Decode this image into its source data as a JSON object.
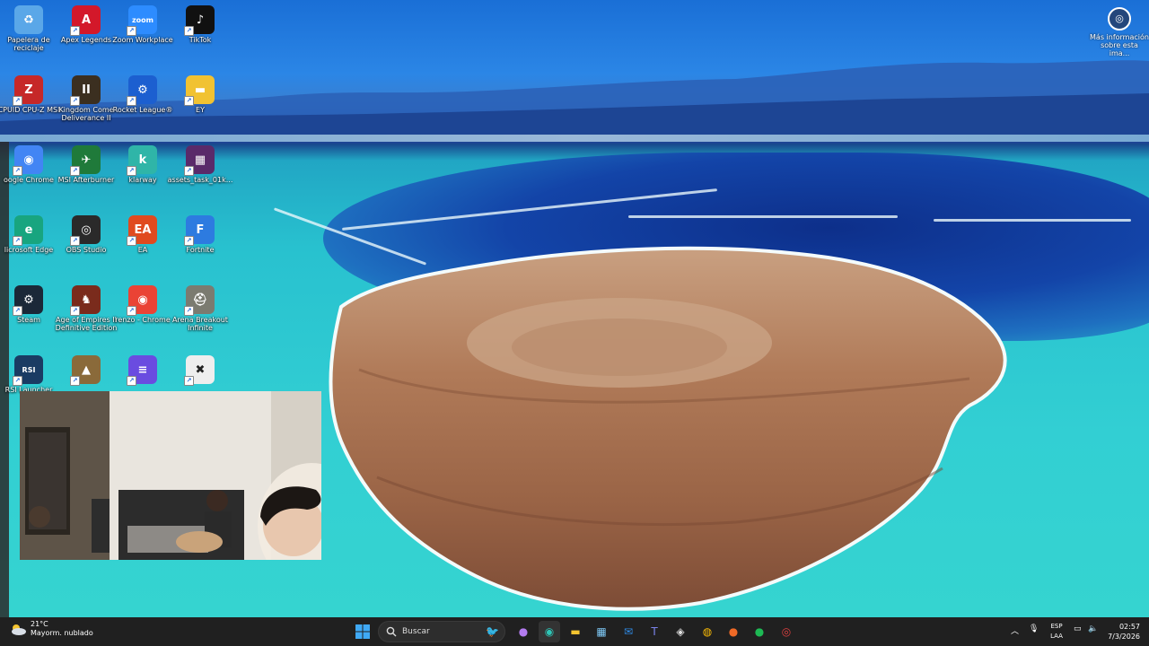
{
  "desktop": {
    "icons": [
      {
        "label": "Papelera de reciclaje",
        "icon": "recycle-bin-icon"
      },
      {
        "label": "Apex Legends",
        "icon": "apex-legends-icon"
      },
      {
        "label": "Zoom Workplace",
        "icon": "zoom-icon"
      },
      {
        "label": "TikTok",
        "icon": "tiktok-icon"
      },
      {
        "label": "CPUID CPU-Z MSI",
        "icon": "cpuz-icon"
      },
      {
        "label": "Kingdom Come Deliverance II",
        "icon": "kingdom-come-icon"
      },
      {
        "label": "Rocket League®",
        "icon": "rocket-league-icon"
      },
      {
        "label": "EY",
        "icon": "folder-icon"
      },
      {
        "label": "oogle Chrome",
        "icon": "chrome-icon"
      },
      {
        "label": "MSI Afterburner",
        "icon": "msi-afterburner-icon"
      },
      {
        "label": "klarway",
        "icon": "klarway-icon"
      },
      {
        "label": "assets_task_01k...",
        "icon": "image-file-icon"
      },
      {
        "label": "licrosoft Edge",
        "icon": "edge-icon"
      },
      {
        "label": "OBS Studio",
        "icon": "obs-icon"
      },
      {
        "label": "EA",
        "icon": "ea-icon"
      },
      {
        "label": "Fortnite",
        "icon": "fortnite-icon"
      },
      {
        "label": "Steam",
        "icon": "steam-icon"
      },
      {
        "label": "Age of Empires II Definitive Edition",
        "icon": "age-of-empires-icon"
      },
      {
        "label": "renzo - Chrome",
        "icon": "chrome-profile-icon"
      },
      {
        "label": "Arena Breakout Infinite",
        "icon": "arena-breakout-icon"
      },
      {
        "label": "RSI Launcher",
        "icon": "rsi-icon"
      },
      {
        "label": "",
        "icon": "game-icon"
      },
      {
        "label": "",
        "icon": "lm-studio-icon"
      },
      {
        "label": "",
        "icon": "foobar-icon"
      }
    ],
    "info_button": {
      "label": "Más información sobre esta ima..."
    }
  },
  "taskbar": {
    "weather_temp": "21°C",
    "weather_desc": "Mayorm. nublado",
    "search_placeholder": "Buscar",
    "language_top": "ESP",
    "language_bottom": "LAA",
    "time": "02:57",
    "date": "7/3/2026"
  },
  "colors": {
    "taskbar_bg": "#202020",
    "accent": "#0078d4"
  }
}
